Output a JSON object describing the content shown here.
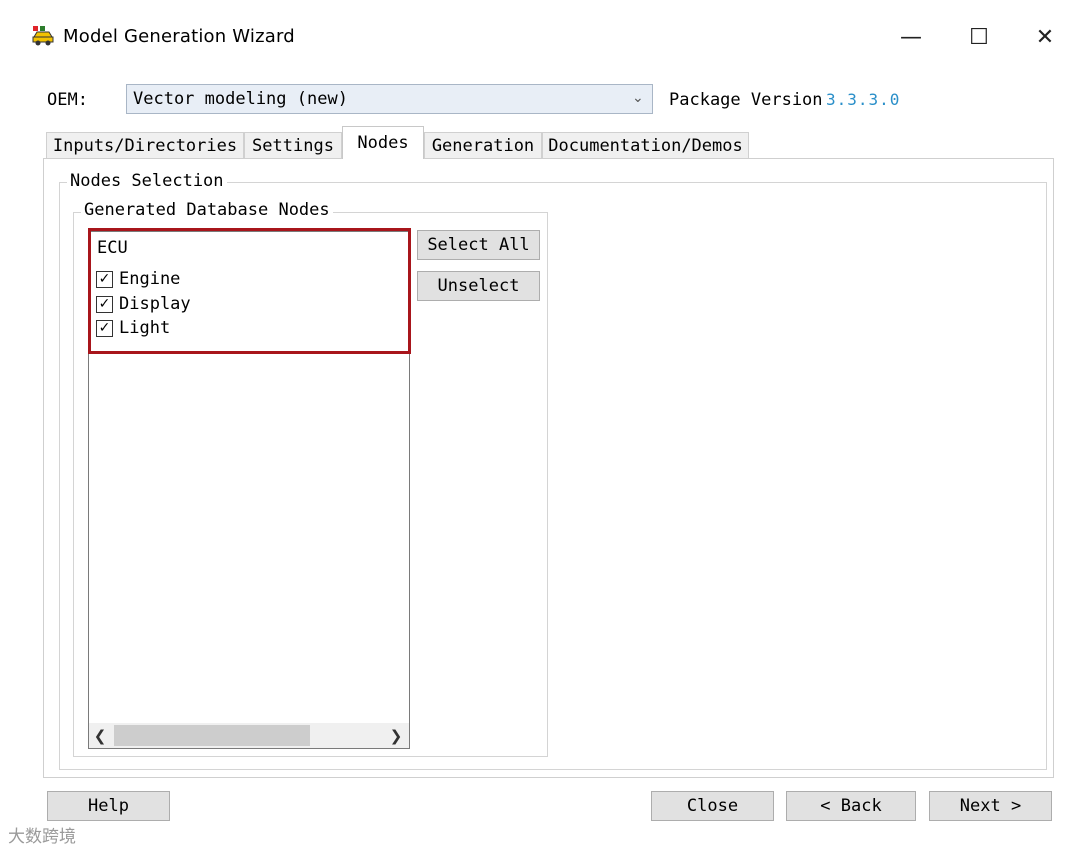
{
  "window": {
    "title": "Model Generation Wizard",
    "icon": "car-app-icon",
    "controls": {
      "minimize": "—",
      "maximize": "☐",
      "close": "✕"
    }
  },
  "oem": {
    "label": "OEM:",
    "selected": "Vector modeling (new)",
    "package_label": "Package Version",
    "package_version": "3.3.3.0"
  },
  "tabs": [
    {
      "label": "Inputs/Directories",
      "active": false
    },
    {
      "label": "Settings",
      "active": false
    },
    {
      "label": "Nodes",
      "active": true
    },
    {
      "label": "Generation",
      "active": false
    },
    {
      "label": "Documentation/Demos",
      "active": false
    }
  ],
  "nodes_selection": {
    "group_label": "Nodes Selection",
    "db_group_label": "Generated Database Nodes",
    "root": "ECU",
    "items": [
      {
        "label": "Engine",
        "checked": true
      },
      {
        "label": "Display",
        "checked": true
      },
      {
        "label": "Light",
        "checked": true
      }
    ],
    "select_all": "Select All",
    "unselect": "Unselect"
  },
  "footer": {
    "help": "Help",
    "close": "Close",
    "back": "< Back",
    "next": "Next >"
  },
  "watermark": "大数跨境",
  "colors": {
    "highlight": "#a8151b",
    "version": "#2a8fc9"
  }
}
